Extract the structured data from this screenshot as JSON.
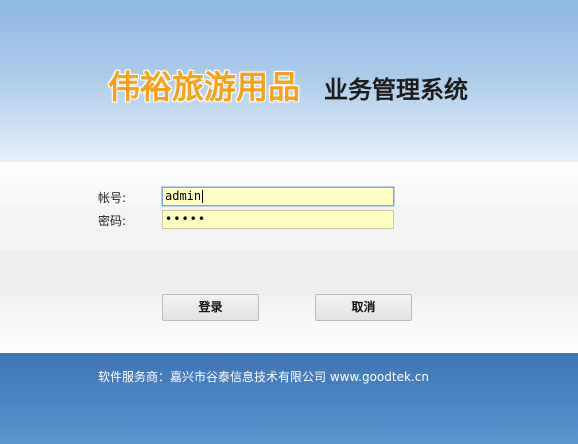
{
  "header": {
    "brand": "伟裕旅游用品",
    "system_title": "业务管理系统"
  },
  "form": {
    "username_label": "帐号:",
    "username_value": "admin",
    "password_label": "密码:",
    "password_mask": "•••••"
  },
  "buttons": {
    "login_label": "登录",
    "cancel_label": "取消"
  },
  "footer": {
    "provider_text": "软件服务商：嘉兴市谷泰信息技术有限公司 www.goodtek.cn"
  },
  "colors": {
    "brand": "#f7a21a",
    "input_background": "#ffffc4",
    "footer_background": "#4a82c0"
  }
}
